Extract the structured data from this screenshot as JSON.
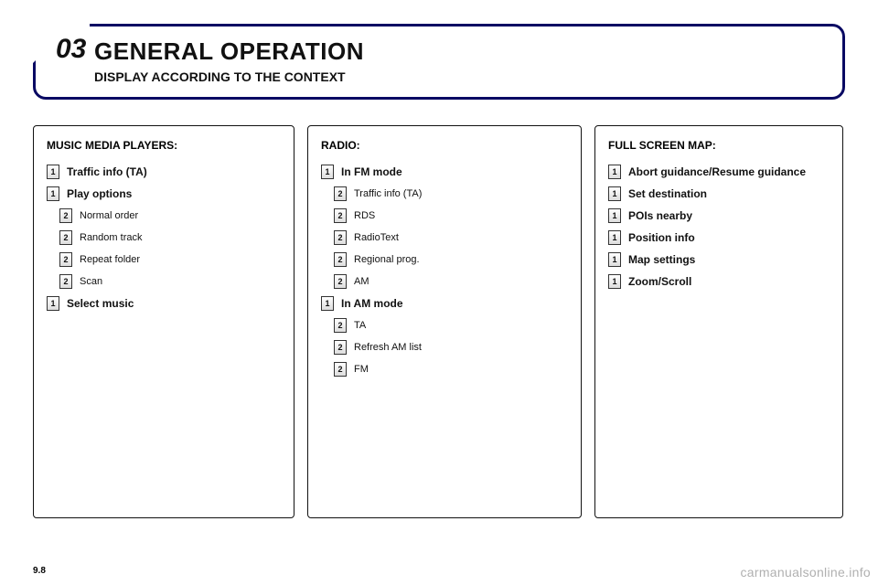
{
  "header": {
    "section_number": "03",
    "title": "GENERAL OPERATION",
    "subtitle": "DISPLAY ACCORDING TO THE CONTEXT"
  },
  "columns": {
    "music": {
      "title": "MUSIC MEDIA PLAYERS:",
      "items": [
        {
          "level": 1,
          "badge": "1",
          "label": "Traffic info (TA)"
        },
        {
          "level": 1,
          "badge": "1",
          "label": "Play options"
        },
        {
          "level": 2,
          "badge": "2",
          "label": "Normal order"
        },
        {
          "level": 2,
          "badge": "2",
          "label": "Random track"
        },
        {
          "level": 2,
          "badge": "2",
          "label": "Repeat folder"
        },
        {
          "level": 2,
          "badge": "2",
          "label": "Scan"
        },
        {
          "level": 1,
          "badge": "1",
          "label": "Select music"
        }
      ]
    },
    "radio": {
      "title": "RADIO:",
      "items": [
        {
          "level": 1,
          "badge": "1",
          "label": "In FM mode"
        },
        {
          "level": 2,
          "badge": "2",
          "label": "Traffic info (TA)"
        },
        {
          "level": 2,
          "badge": "2",
          "label": "RDS"
        },
        {
          "level": 2,
          "badge": "2",
          "label": "RadioText"
        },
        {
          "level": 2,
          "badge": "2",
          "label": "Regional prog."
        },
        {
          "level": 2,
          "badge": "2",
          "label": "AM"
        },
        {
          "level": 1,
          "badge": "1",
          "label": "In AM mode"
        },
        {
          "level": 2,
          "badge": "2",
          "label": "TA"
        },
        {
          "level": 2,
          "badge": "2",
          "label": "Refresh AM list"
        },
        {
          "level": 2,
          "badge": "2",
          "label": "FM"
        }
      ]
    },
    "map": {
      "title": "FULL SCREEN MAP:",
      "items": [
        {
          "level": 1,
          "badge": "1",
          "label": "Abort guidance/Resume guidance"
        },
        {
          "level": 1,
          "badge": "1",
          "label": "Set destination"
        },
        {
          "level": 1,
          "badge": "1",
          "label": "POIs nearby"
        },
        {
          "level": 1,
          "badge": "1",
          "label": "Position info"
        },
        {
          "level": 1,
          "badge": "1",
          "label": "Map settings"
        },
        {
          "level": 1,
          "badge": "1",
          "label": "Zoom/Scroll"
        }
      ]
    }
  },
  "page_number": "9.8",
  "watermark": "carmanualsonline.info"
}
